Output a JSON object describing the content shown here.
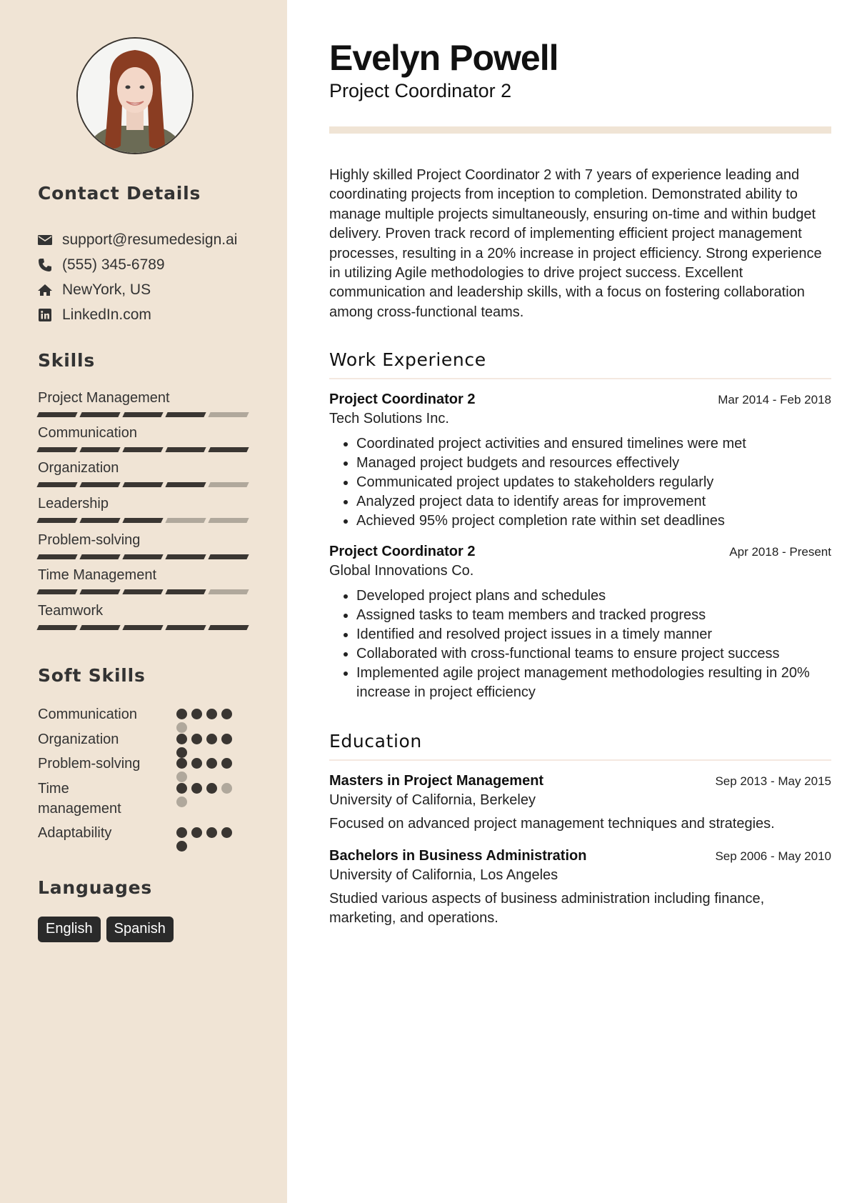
{
  "profile": {
    "name": "Evelyn Powell",
    "title": "Project Coordinator 2",
    "photo_alt": "Profile photo of Evelyn Powell"
  },
  "theme": {
    "sidebar_bg": "#f0e4d5",
    "dark": "#3a3632",
    "muted": "#b0a89c"
  },
  "contact": {
    "heading": "Contact Details",
    "items": [
      {
        "icon": "envelope-icon",
        "text": "support@resumedesign.ai"
      },
      {
        "icon": "phone-icon",
        "text": "(555) 345-6789"
      },
      {
        "icon": "home-icon",
        "text": "NewYork, US"
      },
      {
        "icon": "linkedin-icon",
        "text": "LinkedIn.com"
      }
    ]
  },
  "skills": {
    "heading": "Skills",
    "max": 5,
    "items": [
      {
        "name": "Project Management",
        "level": 4
      },
      {
        "name": "Communication",
        "level": 5
      },
      {
        "name": "Organization",
        "level": 4
      },
      {
        "name": "Leadership",
        "level": 3
      },
      {
        "name": "Problem-solving",
        "level": 5
      },
      {
        "name": "Time Management",
        "level": 4
      },
      {
        "name": "Teamwork",
        "level": 5
      }
    ]
  },
  "soft_skills": {
    "heading": "Soft Skills",
    "max": 5,
    "items": [
      {
        "name": "Communication",
        "level": 4
      },
      {
        "name": "Organization",
        "level": 5
      },
      {
        "name": "Problem-solving",
        "level": 4
      },
      {
        "name": "Time management",
        "level": 3
      },
      {
        "name": "Adaptability",
        "level": 5
      }
    ]
  },
  "languages": {
    "heading": "Languages",
    "items": [
      "English",
      "Spanish"
    ]
  },
  "summary": "Highly skilled Project Coordinator 2 with 7 years of experience leading and coordinating projects from inception to completion. Demonstrated ability to manage multiple projects simultaneously, ensuring on-time and within budget delivery. Proven track record of implementing efficient project management processes, resulting in a 20% increase in project efficiency. Strong experience in utilizing Agile methodologies to drive project success. Excellent communication and leadership skills, with a focus on fostering collaboration among cross-functional teams.",
  "experience": {
    "heading": "Work Experience",
    "jobs": [
      {
        "title": "Project Coordinator 2",
        "company": "Tech Solutions Inc.",
        "dates": "Mar 2014 - Feb 2018",
        "bullets": [
          "Coordinated project activities and ensured timelines were met",
          "Managed project budgets and resources effectively",
          "Communicated project updates to stakeholders regularly",
          "Analyzed project data to identify areas for improvement",
          "Achieved 95% project completion rate within set deadlines"
        ]
      },
      {
        "title": "Project Coordinator 2",
        "company": "Global Innovations Co.",
        "dates": "Apr 2018 - Present",
        "bullets": [
          "Developed project plans and schedules",
          "Assigned tasks to team members and tracked progress",
          "Identified and resolved project issues in a timely manner",
          "Collaborated with cross-functional teams to ensure project success",
          "Implemented agile project management methodologies resulting in 20% increase in project efficiency"
        ]
      }
    ]
  },
  "education": {
    "heading": "Education",
    "items": [
      {
        "degree": "Masters in Project Management",
        "school": "University of California, Berkeley",
        "dates": "Sep 2013 - May 2015",
        "description": "Focused on advanced project management techniques and strategies."
      },
      {
        "degree": "Bachelors in Business Administration",
        "school": "University of California, Los Angeles",
        "dates": "Sep 2006 - May 2010",
        "description": "Studied various aspects of business administration including finance, marketing, and operations."
      }
    ]
  }
}
